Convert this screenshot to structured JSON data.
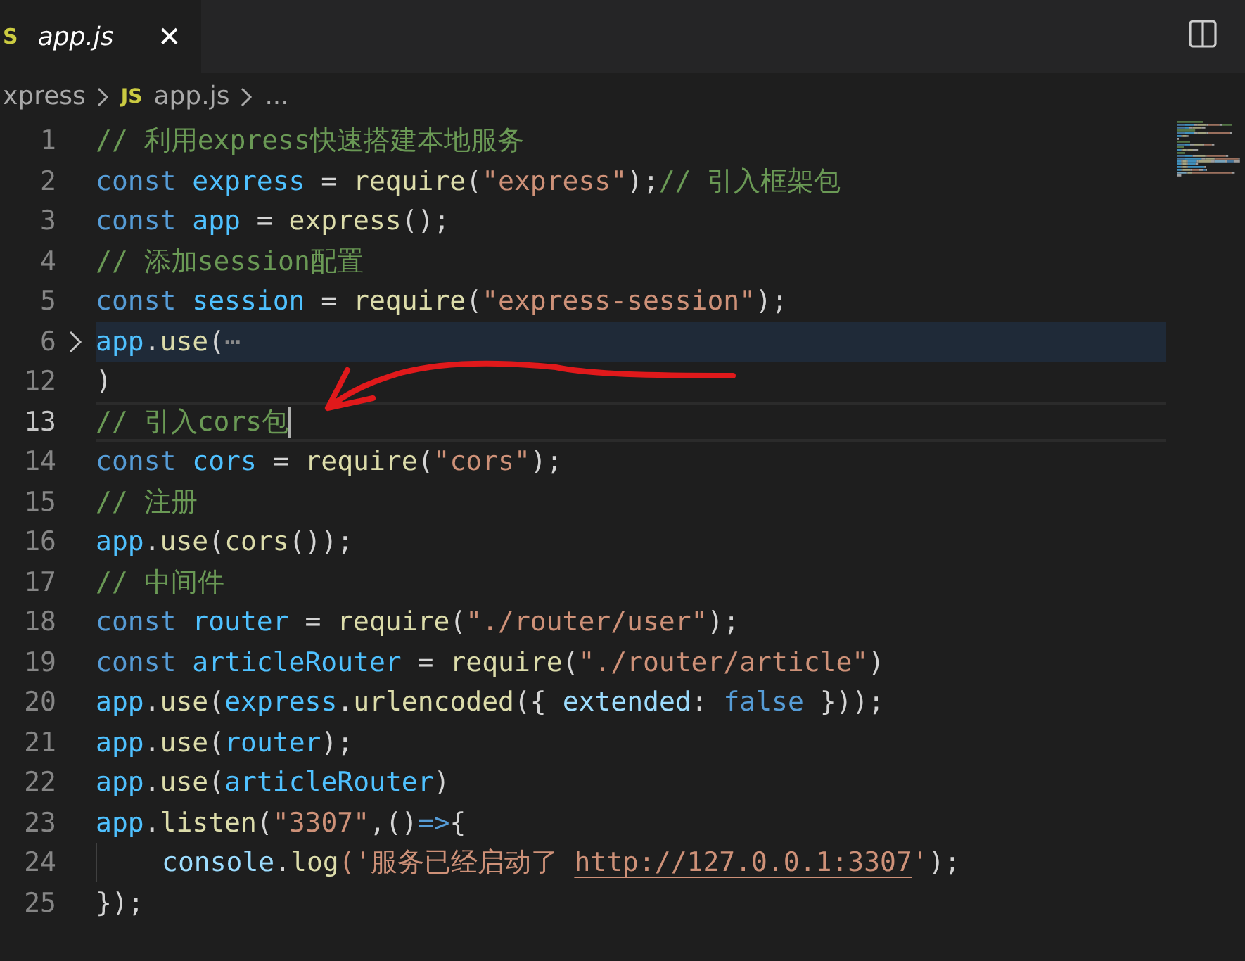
{
  "tab": {
    "label": "app.js",
    "badge": "S",
    "selected": true,
    "close": "✕"
  },
  "breadcrumb": {
    "folder": "xpress",
    "badge": "JS",
    "file": "app.js",
    "more": "..."
  },
  "lines": [
    {
      "number": "1",
      "current": false,
      "folded": false,
      "tokens": [
        {
          "text": "// 利用express快速搭建本地服务",
          "kind": "comment"
        }
      ]
    },
    {
      "number": "2",
      "current": false,
      "folded": false,
      "tokens": [
        {
          "text": "const ",
          "kind": "keyword"
        },
        {
          "text": "express",
          "kind": "constant"
        },
        {
          "text": " = ",
          "kind": "plain"
        },
        {
          "text": "require",
          "kind": "function"
        },
        {
          "text": "(",
          "kind": "plain"
        },
        {
          "text": "\"express\"",
          "kind": "string"
        },
        {
          "text": ");",
          "kind": "plain"
        },
        {
          "text": "// 引入框架包",
          "kind": "comment"
        }
      ]
    },
    {
      "number": "3",
      "current": false,
      "folded": false,
      "tokens": [
        {
          "text": "const ",
          "kind": "keyword"
        },
        {
          "text": "app",
          "kind": "constant"
        },
        {
          "text": " = ",
          "kind": "plain"
        },
        {
          "text": "express",
          "kind": "function"
        },
        {
          "text": "();",
          "kind": "plain"
        }
      ]
    },
    {
      "number": "4",
      "current": false,
      "folded": false,
      "tokens": [
        {
          "text": "// 添加session配置",
          "kind": "comment"
        }
      ]
    },
    {
      "number": "5",
      "current": false,
      "folded": false,
      "tokens": [
        {
          "text": "const ",
          "kind": "keyword"
        },
        {
          "text": "session",
          "kind": "constant"
        },
        {
          "text": " = ",
          "kind": "plain"
        },
        {
          "text": "require",
          "kind": "function"
        },
        {
          "text": "(",
          "kind": "plain"
        },
        {
          "text": "\"express-session\"",
          "kind": "string"
        },
        {
          "text": ");",
          "kind": "plain"
        }
      ]
    },
    {
      "number": "6",
      "current": false,
      "folded": true,
      "tokens": [
        {
          "text": "app",
          "kind": "constant"
        },
        {
          "text": ".",
          "kind": "plain"
        },
        {
          "text": "use",
          "kind": "function"
        },
        {
          "text": "(",
          "kind": "plain"
        },
        {
          "text": "⋯",
          "kind": "ellipsis"
        }
      ]
    },
    {
      "number": "12",
      "current": false,
      "folded": false,
      "tokens": [
        {
          "text": ")",
          "kind": "plain"
        }
      ]
    },
    {
      "number": "13",
      "current": true,
      "folded": false,
      "tokens": [
        {
          "text": "// 引入cors包",
          "kind": "comment"
        }
      ]
    },
    {
      "number": "14",
      "current": false,
      "folded": false,
      "tokens": [
        {
          "text": "const ",
          "kind": "keyword"
        },
        {
          "text": "cors",
          "kind": "constant"
        },
        {
          "text": " = ",
          "kind": "plain"
        },
        {
          "text": "require",
          "kind": "function"
        },
        {
          "text": "(",
          "kind": "plain"
        },
        {
          "text": "\"cors\"",
          "kind": "string"
        },
        {
          "text": ");",
          "kind": "plain"
        }
      ]
    },
    {
      "number": "15",
      "current": false,
      "folded": false,
      "tokens": [
        {
          "text": "// 注册",
          "kind": "comment"
        }
      ]
    },
    {
      "number": "16",
      "current": false,
      "folded": false,
      "tokens": [
        {
          "text": "app",
          "kind": "constant"
        },
        {
          "text": ".",
          "kind": "plain"
        },
        {
          "text": "use",
          "kind": "function"
        },
        {
          "text": "(",
          "kind": "plain"
        },
        {
          "text": "cors",
          "kind": "function"
        },
        {
          "text": "());",
          "kind": "plain"
        }
      ]
    },
    {
      "number": "17",
      "current": false,
      "folded": false,
      "tokens": [
        {
          "text": "// 中间件",
          "kind": "comment"
        }
      ]
    },
    {
      "number": "18",
      "current": false,
      "folded": false,
      "tokens": [
        {
          "text": "const ",
          "kind": "keyword"
        },
        {
          "text": "router",
          "kind": "constant"
        },
        {
          "text": " = ",
          "kind": "plain"
        },
        {
          "text": "require",
          "kind": "function"
        },
        {
          "text": "(",
          "kind": "plain"
        },
        {
          "text": "\"./router/user\"",
          "kind": "string"
        },
        {
          "text": ");",
          "kind": "plain"
        }
      ]
    },
    {
      "number": "19",
      "current": false,
      "folded": false,
      "tokens": [
        {
          "text": "const ",
          "kind": "keyword"
        },
        {
          "text": "articleRouter",
          "kind": "constant"
        },
        {
          "text": " = ",
          "kind": "plain"
        },
        {
          "text": "require",
          "kind": "function"
        },
        {
          "text": "(",
          "kind": "plain"
        },
        {
          "text": "\"./router/article\"",
          "kind": "string"
        },
        {
          "text": ")",
          "kind": "plain"
        }
      ]
    },
    {
      "number": "20",
      "current": false,
      "folded": false,
      "tokens": [
        {
          "text": "app",
          "kind": "constant"
        },
        {
          "text": ".",
          "kind": "plain"
        },
        {
          "text": "use",
          "kind": "function"
        },
        {
          "text": "(",
          "kind": "plain"
        },
        {
          "text": "express",
          "kind": "constant"
        },
        {
          "text": ".",
          "kind": "plain"
        },
        {
          "text": "urlencoded",
          "kind": "function"
        },
        {
          "text": "({ ",
          "kind": "plain"
        },
        {
          "text": "extended",
          "kind": "variable"
        },
        {
          "text": ": ",
          "kind": "plain"
        },
        {
          "text": "false",
          "kind": "keyword"
        },
        {
          "text": " }));",
          "kind": "plain"
        }
      ]
    },
    {
      "number": "21",
      "current": false,
      "folded": false,
      "tokens": [
        {
          "text": "app",
          "kind": "constant"
        },
        {
          "text": ".",
          "kind": "plain"
        },
        {
          "text": "use",
          "kind": "function"
        },
        {
          "text": "(",
          "kind": "plain"
        },
        {
          "text": "router",
          "kind": "constant"
        },
        {
          "text": ");",
          "kind": "plain"
        }
      ]
    },
    {
      "number": "22",
      "current": false,
      "folded": false,
      "tokens": [
        {
          "text": "app",
          "kind": "constant"
        },
        {
          "text": ".",
          "kind": "plain"
        },
        {
          "text": "use",
          "kind": "function"
        },
        {
          "text": "(",
          "kind": "plain"
        },
        {
          "text": "articleRouter",
          "kind": "constant"
        },
        {
          "text": ")",
          "kind": "plain"
        }
      ]
    },
    {
      "number": "23",
      "current": false,
      "folded": false,
      "tokens": [
        {
          "text": "app",
          "kind": "constant"
        },
        {
          "text": ".",
          "kind": "plain"
        },
        {
          "text": "listen",
          "kind": "function"
        },
        {
          "text": "(",
          "kind": "plain"
        },
        {
          "text": "\"3307\"",
          "kind": "string"
        },
        {
          "text": ",()",
          "kind": "plain"
        },
        {
          "text": "=>",
          "kind": "keyword"
        },
        {
          "text": "{",
          "kind": "plain"
        }
      ]
    },
    {
      "number": "24",
      "current": false,
      "folded": false,
      "indented": true,
      "tokens": [
        {
          "text": "console",
          "kind": "variable"
        },
        {
          "text": ".",
          "kind": "plain"
        },
        {
          "text": "log",
          "kind": "function"
        },
        {
          "text": "('服务已经启动了 ",
          "kind": "string"
        },
        {
          "text": "http://127.0.0.1:3307",
          "kind": "link"
        },
        {
          "text": "'",
          "kind": "string"
        },
        {
          "text": ");",
          "kind": "plain"
        }
      ]
    },
    {
      "number": "25",
      "current": false,
      "folded": false,
      "tokens": [
        {
          "text": "});",
          "kind": "plain"
        }
      ]
    }
  ]
}
